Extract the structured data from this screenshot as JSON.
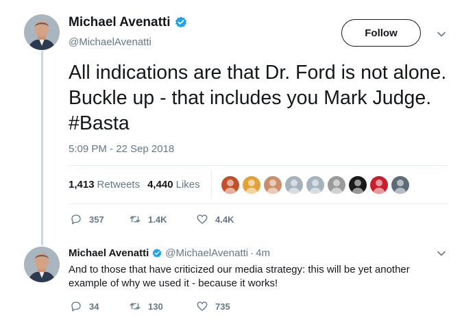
{
  "tweet": {
    "author_name": "Michael Avenatti",
    "handle": "@MichaelAvenatti",
    "follow_label": "Follow",
    "text": "All indications are that Dr. Ford is not alone. Buckle up - that includes you Mark Judge. #Basta",
    "timestamp": "5:09 PM - 22 Sep 2018",
    "retweets_count": "1,413",
    "retweets_label": "Retweets",
    "likes_count": "4,440",
    "likes_label": "Likes",
    "liker_avatar_colors": [
      "#c0522b",
      "#e0a33a",
      "#c98f6b",
      "#a7b3bc",
      "#a7b3bc",
      "#9a9a9a",
      "#1a1a1a",
      "#c61f2e",
      "#5b6b78"
    ],
    "actions": {
      "replies": "357",
      "retweets": "1.4K",
      "likes": "4.4K"
    }
  },
  "reply": {
    "author_name": "Michael Avenatti",
    "handle": "@MichaelAvenatti",
    "separator": "·",
    "time": "4m",
    "text": "And to those that have criticized our media strategy: this will be yet another example of why we used it - because it works!",
    "actions": {
      "replies": "34",
      "retweets": "130",
      "likes": "735"
    }
  },
  "colors": {
    "verified": "#1da1f2",
    "secondary_text": "#657786",
    "primary_text": "#14171a"
  },
  "icons": [
    "verified-badge-icon",
    "chevron-down-icon",
    "reply-icon",
    "retweet-icon",
    "like-icon"
  ]
}
